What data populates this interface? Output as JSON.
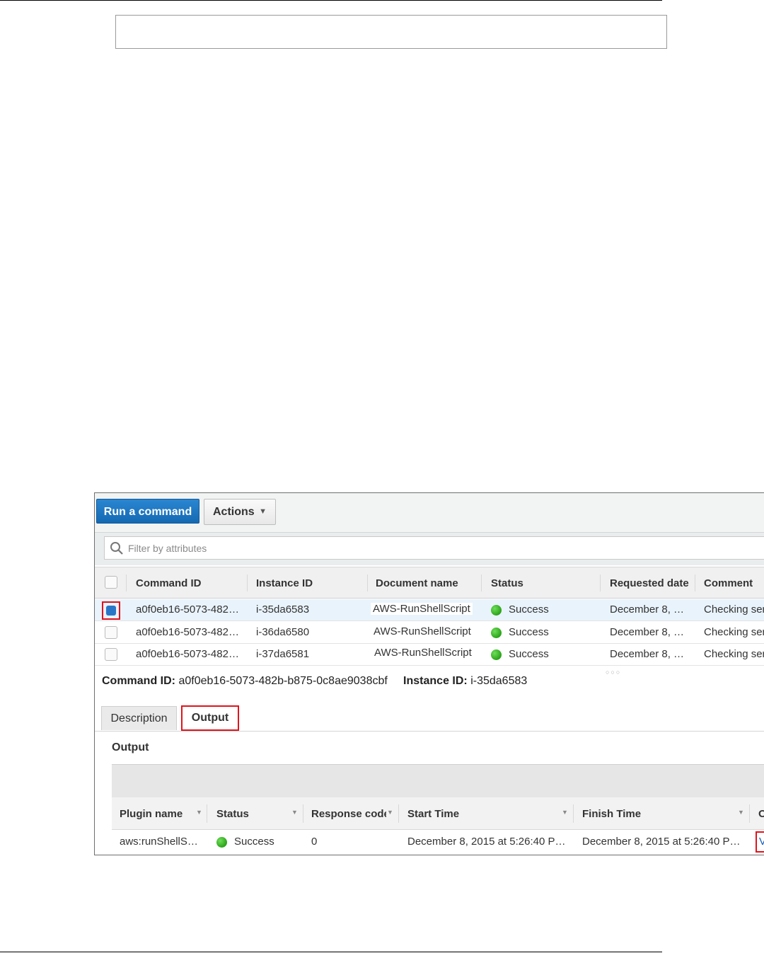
{
  "toolbar": {
    "run_label": "Run a command",
    "actions_label": "Actions"
  },
  "filter": {
    "placeholder": "Filter by attributes"
  },
  "grid": {
    "headers": {
      "command_id": "Command ID",
      "instance_id": "Instance ID",
      "document_name": "Document name",
      "status": "Status",
      "requested_date": "Requested date",
      "comment": "Comment"
    },
    "rows": [
      {
        "command_id": "a0f0eb16-5073-482…",
        "instance_id": "i-35da6583",
        "document_name": "AWS-RunShellScript",
        "status": "Success",
        "requested_date": "December 8, …",
        "comment": "Checking ser"
      },
      {
        "command_id": "a0f0eb16-5073-482…",
        "instance_id": "i-36da6580",
        "document_name": "AWS-RunShellScript",
        "status": "Success",
        "requested_date": "December 8, …",
        "comment": "Checking ser"
      },
      {
        "command_id": "a0f0eb16-5073-482…",
        "instance_id": "i-37da6581",
        "document_name": "AWS-RunShellScript",
        "status": "Success",
        "requested_date": "December 8, …",
        "comment": "Checking ser"
      }
    ]
  },
  "summary": {
    "command_label": "Command ID:",
    "command_value": "a0f0eb16-5073-482b-b875-0c8ae9038cbf",
    "instance_label": "Instance ID:",
    "instance_value": "i-35da6583"
  },
  "tabs": {
    "description": "Description",
    "output": "Output"
  },
  "output": {
    "title": "Output",
    "headers": {
      "plugin_name": "Plugin name",
      "status": "Status",
      "response_code": "Response code",
      "start_time": "Start Time",
      "finish_time": "Finish Time",
      "extra": "O"
    },
    "row": {
      "plugin_name": "aws:runShellS…",
      "status": "Success",
      "response_code": "0",
      "start_time": "December 8, 2015 at 5:26:40 P…",
      "finish_time": "December 8, 2015 at 5:26:40 P…",
      "link": "V"
    }
  },
  "colors": {
    "primary_button": "#1f78c8",
    "highlight": "#e0131c",
    "success": "#2aa318",
    "selected_row": "#e9f3fb"
  },
  "icons": [
    "search-icon",
    "chevron-down-icon",
    "success-status-icon"
  ]
}
